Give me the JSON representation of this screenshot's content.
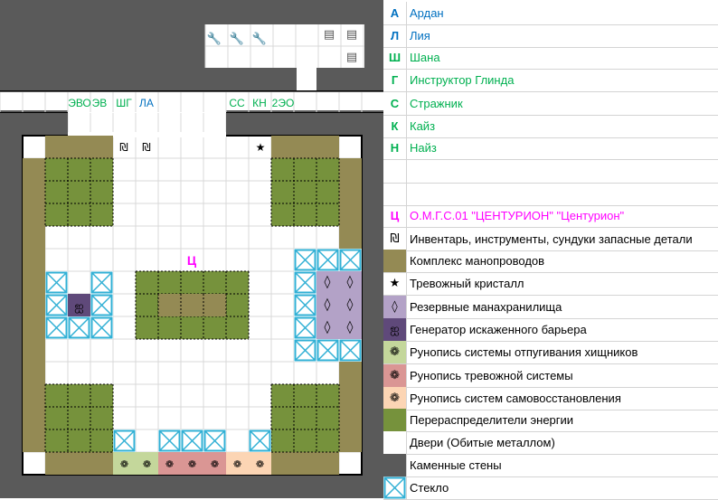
{
  "tiles": {
    "wall": "#5a5a5a",
    "grid_line": "#d9d9d9",
    "floor": "#ffffff",
    "manapipe": "#948a54",
    "redistributor": "#76923c",
    "reserve": "#b3a2c7",
    "generator": "#5f497a",
    "rune_green": "#c4d79b",
    "rune_red": "#da9694",
    "rune_orange": "#fcd5b4",
    "glass_line": "#31b0d5",
    "name_blue": "#0070c0",
    "name_green": "#00b050",
    "boss_color": "#ff00ff"
  },
  "map": {
    "hallway_labels": [
      {
        "text": "ЭВО",
        "color": "#00b050"
      },
      {
        "text": "ЭВ",
        "color": "#00b050"
      },
      {
        "text": "ШГ",
        "color": "#00b050"
      },
      {
        "text": "ЛА",
        "color": "#0070c0"
      },
      {
        "text": "СС",
        "color": "#00b050"
      },
      {
        "text": "КН",
        "color": "#00b050"
      },
      {
        "text": "2ЭО",
        "color": "#00b050"
      }
    ],
    "boss_marker": "Ц",
    "inventory_glyph": "₪",
    "alarm_glyph": "★",
    "reserve_glyph": "◊",
    "generator_glyph": "ஐ",
    "rune_glyph": "❁",
    "wrench_glyph": "🔧",
    "scroll_glyph": "▤"
  },
  "legend": {
    "items": [
      {
        "symbol": "А",
        "text": "Ардан",
        "color": "#0070c0",
        "swatch": ""
      },
      {
        "symbol": "Л",
        "text": "Лия",
        "color": "#0070c0",
        "swatch": ""
      },
      {
        "symbol": "Ш",
        "text": "Шана",
        "color": "#00b050",
        "swatch": ""
      },
      {
        "symbol": "Г",
        "text": "Инструктор Глинда",
        "color": "#00b050",
        "swatch": ""
      },
      {
        "symbol": "С",
        "text": "Стражник",
        "color": "#00b050",
        "swatch": ""
      },
      {
        "symbol": "К",
        "text": "Кайз",
        "color": "#00b050",
        "swatch": ""
      },
      {
        "symbol": "Н",
        "text": "Найз",
        "color": "#00b050",
        "swatch": ""
      },
      {
        "symbol": "",
        "text": "",
        "color": "#000000",
        "swatch": ""
      },
      {
        "symbol": "",
        "text": "",
        "color": "#000000",
        "swatch": ""
      },
      {
        "symbol": "Ц",
        "text": "О.М.Г.С.01 \"ЦЕНТУРИОН\" \"Центурион\"",
        "color": "#ff00ff",
        "swatch": ""
      },
      {
        "symbol": "₪",
        "text": "Инвентарь, инструменты, сундуки запасные детали",
        "color": "#000000",
        "swatch": ""
      },
      {
        "symbol": "",
        "text": "Комплекс манопроводов",
        "color": "#000000",
        "swatch": "#948a54"
      },
      {
        "symbol": "★",
        "text": "Тревожный кристалл",
        "color": "#000000",
        "swatch": ""
      },
      {
        "symbol": "◊",
        "text": "Резервные манахранилища",
        "color": "#000000",
        "swatch": "#b3a2c7"
      },
      {
        "symbol": "ஐ",
        "text": "Генератор искаженного барьера",
        "color": "#000000",
        "swatch": "#5f497a"
      },
      {
        "symbol": "❁",
        "text": "Рунопись системы отпугивания хищников",
        "color": "#000000",
        "swatch": "#c4d79b"
      },
      {
        "symbol": "❁",
        "text": "Рунопись тревожной системы",
        "color": "#000000",
        "swatch": "#da9694"
      },
      {
        "symbol": "❁",
        "text": "Рунопись систем самовосстановления",
        "color": "#000000",
        "swatch": "#fcd5b4"
      },
      {
        "symbol": "",
        "text": "Перераспределители энергии",
        "color": "#000000",
        "swatch": "#76923c"
      },
      {
        "symbol": "",
        "text": "Двери (Обитые металлом)",
        "color": "#000000",
        "swatch": "#ffffff"
      },
      {
        "symbol": "",
        "text": "Каменные стены",
        "color": "#000000",
        "swatch": "#5a5a5a"
      },
      {
        "symbol": "",
        "text": "Стекло",
        "color": "#000000",
        "swatch": "glass"
      }
    ]
  }
}
